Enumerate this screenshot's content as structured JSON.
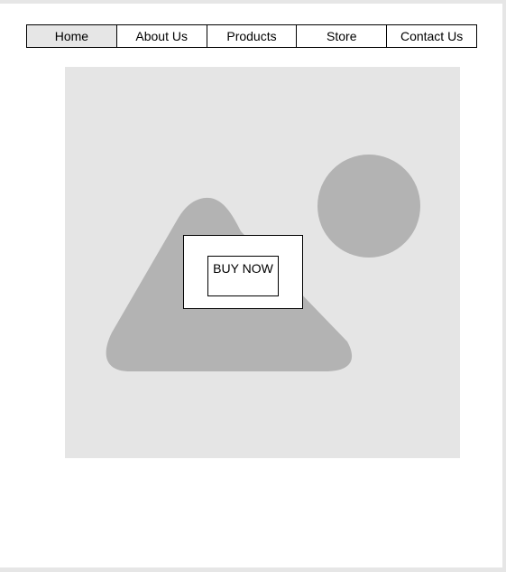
{
  "nav": {
    "items": [
      {
        "label": "Home"
      },
      {
        "label": "About Us"
      },
      {
        "label": "Products"
      },
      {
        "label": "Store"
      },
      {
        "label": "Contact Us"
      }
    ]
  },
  "hero": {
    "image_placeholder_icon": "image-placeholder-icon"
  },
  "cta": {
    "label": "BUY NOW"
  },
  "colors": {
    "page_background": "#ffffff",
    "placeholder_background": "#e5e5e5",
    "placeholder_shapes": "#b3b3b3",
    "active_nav_background": "#e6e6e6",
    "border": "#000000"
  }
}
